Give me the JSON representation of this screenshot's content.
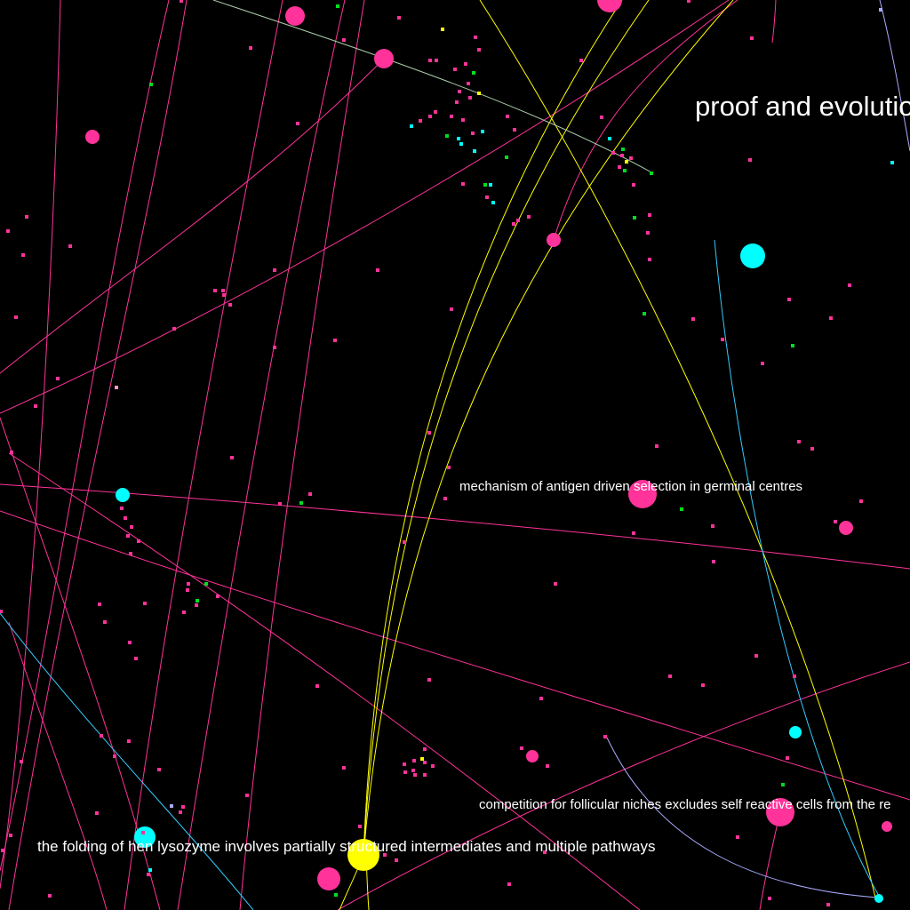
{
  "colors": {
    "background": "#000000",
    "magenta": "#ff3399",
    "yellow": "#ffff00",
    "cyan": "#00ffff",
    "green": "#00dd22",
    "lavender": "#aaaaff",
    "pink_light": "#ff99cc",
    "label": "#ffffff"
  },
  "labels": {
    "proof_evolution": "proof and evolutio",
    "antigen_selection": "mechanism of antigen driven selection in germinal centres",
    "follicular_niches": "competition for follicular niches excludes self reactive cells from the re",
    "lysozyme_folding": "the folding of hen lysozyme involves partially structured intermediates and multiple pathways"
  }
}
